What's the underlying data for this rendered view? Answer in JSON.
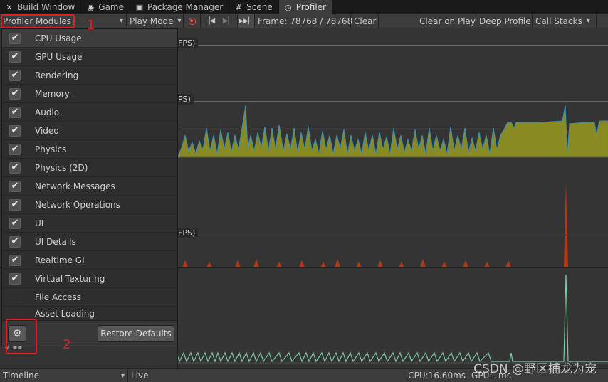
{
  "tabs": [
    {
      "label": "Build Window",
      "icon": "tools-icon"
    },
    {
      "label": "Game",
      "icon": "gamepad-icon"
    },
    {
      "label": "Package Manager",
      "icon": "package-icon"
    },
    {
      "label": "Scene",
      "icon": "grid-icon"
    },
    {
      "label": "Profiler",
      "icon": "stopwatch-icon",
      "active": true
    }
  ],
  "toolbar": {
    "modules_label": "Profiler Modules",
    "play_mode_label": "Play Mode",
    "frame_text": "Frame: 78768 / 78768",
    "clear_label": "Clear",
    "clear_on_play_label": "Clear on Play",
    "deep_profile_label": "Deep Profile",
    "call_stacks_label": "Call Stacks"
  },
  "modules": [
    {
      "label": "CPU Usage",
      "checked": true
    },
    {
      "label": "GPU Usage",
      "checked": true
    },
    {
      "label": "Rendering",
      "checked": true
    },
    {
      "label": "Memory",
      "checked": true
    },
    {
      "label": "Audio",
      "checked": true
    },
    {
      "label": "Video",
      "checked": true
    },
    {
      "label": "Physics",
      "checked": true
    },
    {
      "label": "Physics (2D)",
      "checked": true
    },
    {
      "label": "Network Messages",
      "checked": true
    },
    {
      "label": "Network Operations",
      "checked": true
    },
    {
      "label": "UI",
      "checked": true
    },
    {
      "label": "UI Details",
      "checked": true
    },
    {
      "label": "Realtime GI",
      "checked": true
    },
    {
      "label": "Virtual Texturing",
      "checked": true
    },
    {
      "label": "File Access",
      "checked": false
    },
    {
      "label": "Asset Loading",
      "checked": false
    }
  ],
  "footer": {
    "restore_label": "Restore Defaults"
  },
  "fps_labels": [
    "FPS)",
    "PS)",
    "FPS)"
  ],
  "bottombar": {
    "view_label": "Timeline",
    "live_label": "Live",
    "cpu_text": "CPU:16.60ms",
    "gpu_text": "GPU:--ms"
  },
  "annotations": {
    "one": "1",
    "two": "2"
  },
  "watermark": "CSDN @野区捕龙为宠",
  "colors": {
    "cpu_fill": "#8a8a22",
    "cpu_blue": "#3a8fb8",
    "render_spike": "#b03a18",
    "line_green": "#7fc6a4",
    "annotation": "#e02020"
  }
}
